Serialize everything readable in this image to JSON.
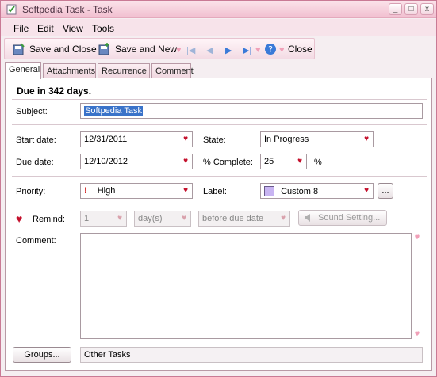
{
  "window": {
    "title": "Softpedia Task - Task"
  },
  "titlebar_buttons": {
    "minimize": "_",
    "restore": "□",
    "close": "x"
  },
  "menu": {
    "file": "File",
    "edit": "Edit",
    "view": "View",
    "tools": "Tools"
  },
  "toolbar": {
    "save_close": "Save and Close",
    "save_new": "Save and New",
    "close": "Close"
  },
  "tabs": [
    "General",
    "Attachments",
    "Recurrence",
    "Comment"
  ],
  "general": {
    "due_text": "Due in 342 days.",
    "subject_label": "Subject:",
    "subject_value": "Softpedia Task",
    "start_date_label": "Start date:",
    "start_date_value": "12/31/2011",
    "state_label": "State:",
    "state_value": "In Progress",
    "due_date_label": "Due date:",
    "due_date_value": "12/10/2012",
    "complete_label": "% Complete:",
    "complete_value": "25",
    "complete_unit": "%",
    "priority_label": "Priority:",
    "priority_icon": "!",
    "priority_value": "High",
    "label_label": "Label:",
    "label_value": "Custom 8",
    "label_color": "#c8b4f2",
    "label_more": "...",
    "remind_label": "Remind:",
    "remind_value": "1",
    "remind_unit": "day(s)",
    "remind_when": "before due date",
    "sound_setting": "Sound Setting...",
    "comment_label": "Comment:",
    "comment_value": "",
    "groups_button": "Groups...",
    "groups_value": "Other Tasks"
  },
  "colors": {
    "accent": "#c4102c",
    "tab_border": "#b89aa6",
    "selection": "#3a73c9"
  }
}
